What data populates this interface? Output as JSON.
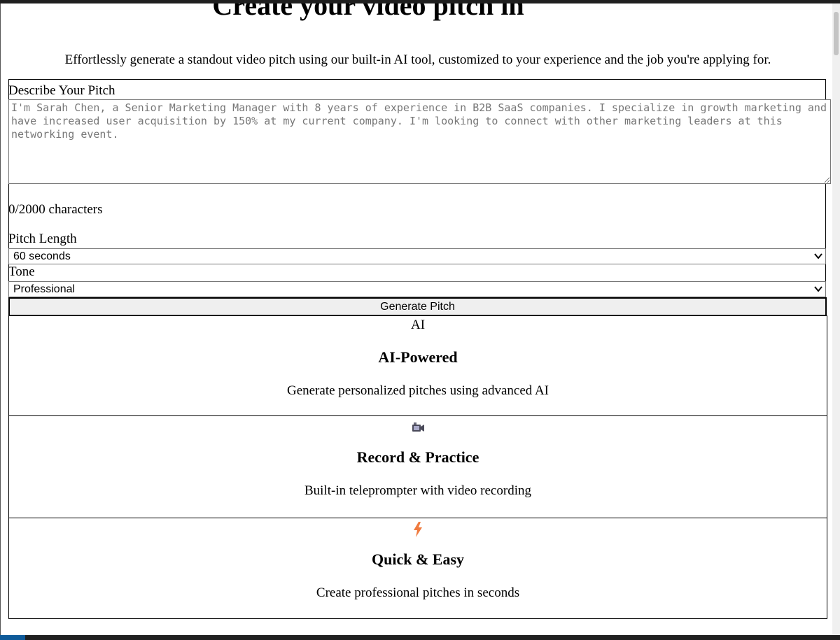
{
  "header": {
    "title": "Create your video pitch in",
    "subtitle": "Effortlessly generate a standout video pitch using our built-in AI tool, customized to your experience and the job you're applying for."
  },
  "form": {
    "describe_label": "Describe Your Pitch",
    "describe_placeholder": "I'm Sarah Chen, a Senior Marketing Manager with 8 years of experience in B2B SaaS companies. I specialize in growth marketing and have increased user acquisition by 150% at my current company. I'm looking to connect with other marketing leaders at this networking event.",
    "char_count": "0/2000 characters",
    "length_label": "Pitch Length",
    "length_value": "60 seconds",
    "tone_label": "Tone",
    "tone_value": "Professional",
    "generate_label": "Generate Pitch"
  },
  "features": [
    {
      "icon": "AI",
      "icon_name": "ai-text-icon",
      "title": "AI-Powered",
      "description": "Generate personalized pitches using advanced AI"
    },
    {
      "icon": "📹",
      "icon_name": "video-camera-icon",
      "title": "Record & Practice",
      "description": "Built-in teleprompter with video recording"
    },
    {
      "icon": "⚡",
      "icon_name": "lightning-icon",
      "title": "Quick & Easy",
      "description": "Create professional pitches in seconds"
    }
  ],
  "colors": {
    "lightning": "#f07b3f",
    "border": "#000000",
    "button_bg": "#efefef"
  }
}
